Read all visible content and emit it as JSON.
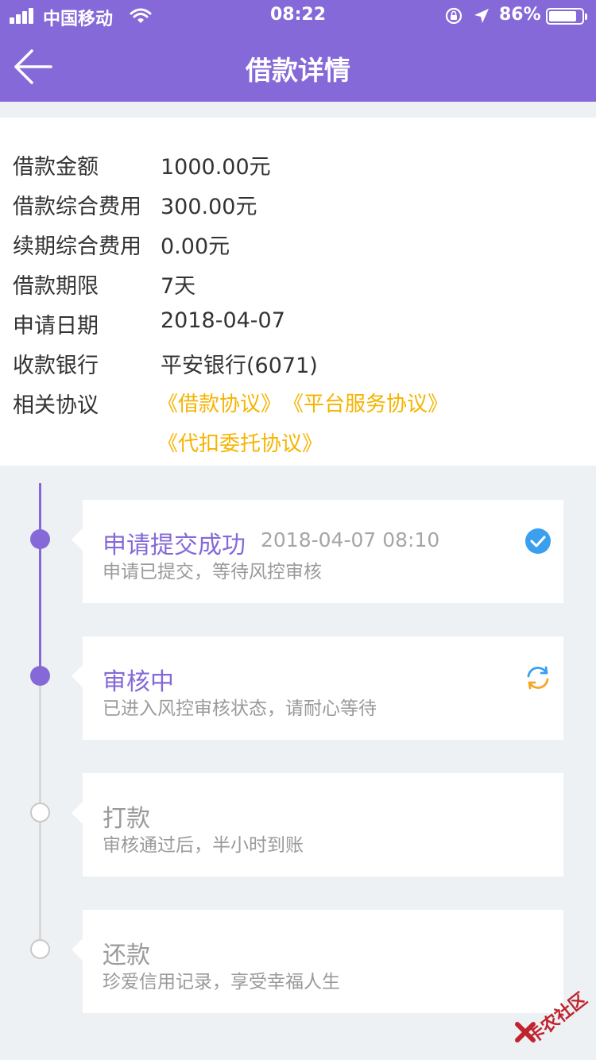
{
  "status_bar": {
    "carrier": "中国移动",
    "time": "08:22",
    "battery_percent": "86%",
    "battery_level": 0.86,
    "icons": [
      "signal-icon",
      "wifi-icon",
      "rotation-lock-icon",
      "location-icon",
      "battery-icon"
    ]
  },
  "nav": {
    "title": "借款详情",
    "back_icon": "back-arrow-icon"
  },
  "details": {
    "rows": [
      {
        "label": "借款金额",
        "value": "1000.00元"
      },
      {
        "label": "借款综合费用",
        "value": "300.00元"
      },
      {
        "label": "续期综合费用",
        "value": "0.00元"
      },
      {
        "label": "借款期限",
        "value": "7天"
      },
      {
        "label": "申请日期",
        "value": "2018-04-07"
      },
      {
        "label": "收款银行",
        "value": "平安银行(6071)"
      }
    ],
    "agreements_label": "相关协议",
    "agreements": [
      "《借款协议》",
      "《平台服务协议》",
      "《代扣委托协议》"
    ]
  },
  "steps": [
    {
      "title": "申请提交成功",
      "time": "2018-04-07 08:10",
      "desc": "申请已提交，等待风控审核",
      "state": "done",
      "icon": "check-circle-icon"
    },
    {
      "title": "审核中",
      "time": "",
      "desc": "已进入风控审核状态，请耐心等待",
      "state": "in-progress",
      "icon": "refresh-icon"
    },
    {
      "title": "打款",
      "time": "",
      "desc": "审核通过后，半小时到账",
      "state": "pending",
      "icon": ""
    },
    {
      "title": "还款",
      "time": "",
      "desc": "珍爱信用记录，享受幸福人生",
      "state": "pending",
      "icon": ""
    }
  ],
  "colors": {
    "primary": "#8569d8",
    "agreement_link": "#f5b400",
    "check_blue": "#3aa0ee",
    "refresh_orange": "#f5a623",
    "refresh_blue": "#3aa0ee"
  },
  "watermark": {
    "text": "卡农社区"
  }
}
